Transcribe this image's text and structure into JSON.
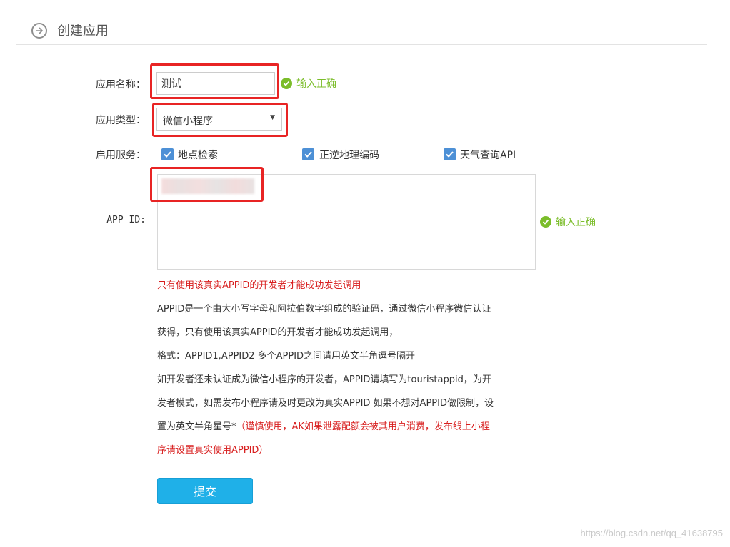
{
  "header": {
    "title": "创建应用"
  },
  "form": {
    "app_name": {
      "label": "应用名称：",
      "value": "测试",
      "status": "输入正确"
    },
    "app_type": {
      "label": "应用类型：",
      "selected": "微信小程序"
    },
    "services": {
      "label": "启用服务：",
      "items": [
        {
          "label": "地点检索",
          "checked": true
        },
        {
          "label": "正逆地理编码",
          "checked": true
        },
        {
          "label": "天气查询API",
          "checked": true
        }
      ]
    },
    "app_id": {
      "label": "APP ID:",
      "status": "输入正确"
    }
  },
  "help": {
    "warning": "只有使用该真实APPID的开发者才能成功发起调用",
    "line1": "APPID是一个由大小写字母和阿拉伯数字组成的验证码，通过微信小程序微信认证",
    "line2": "获得，只有使用该真实APPID的开发者才能成功发起调用，",
    "line3": "格式：APPID1,APPID2 多个APPID之间请用英文半角逗号隔开",
    "line4": "如开发者还未认证成为微信小程序的开发者，APPID请填写为touristappid，为开",
    "line5": "发者模式，如需发布小程序请及时更改为真实APPID 如果不想对APPID做限制，设",
    "line6_prefix": "置为英文半角星号*",
    "line6_red": "（谨慎使用，AK如果泄露配额会被其用户消费，发布线上小程",
    "line7_red": "序请设置真实使用APPID）"
  },
  "submit_label": "提交",
  "watermark": "https://blog.csdn.net/qq_41638795",
  "colors": {
    "accent": "#1fb0e8",
    "success": "#7bbd2a",
    "warning": "#d81e1e",
    "annotation": "#e82424",
    "checkbox": "#4d90d6"
  }
}
